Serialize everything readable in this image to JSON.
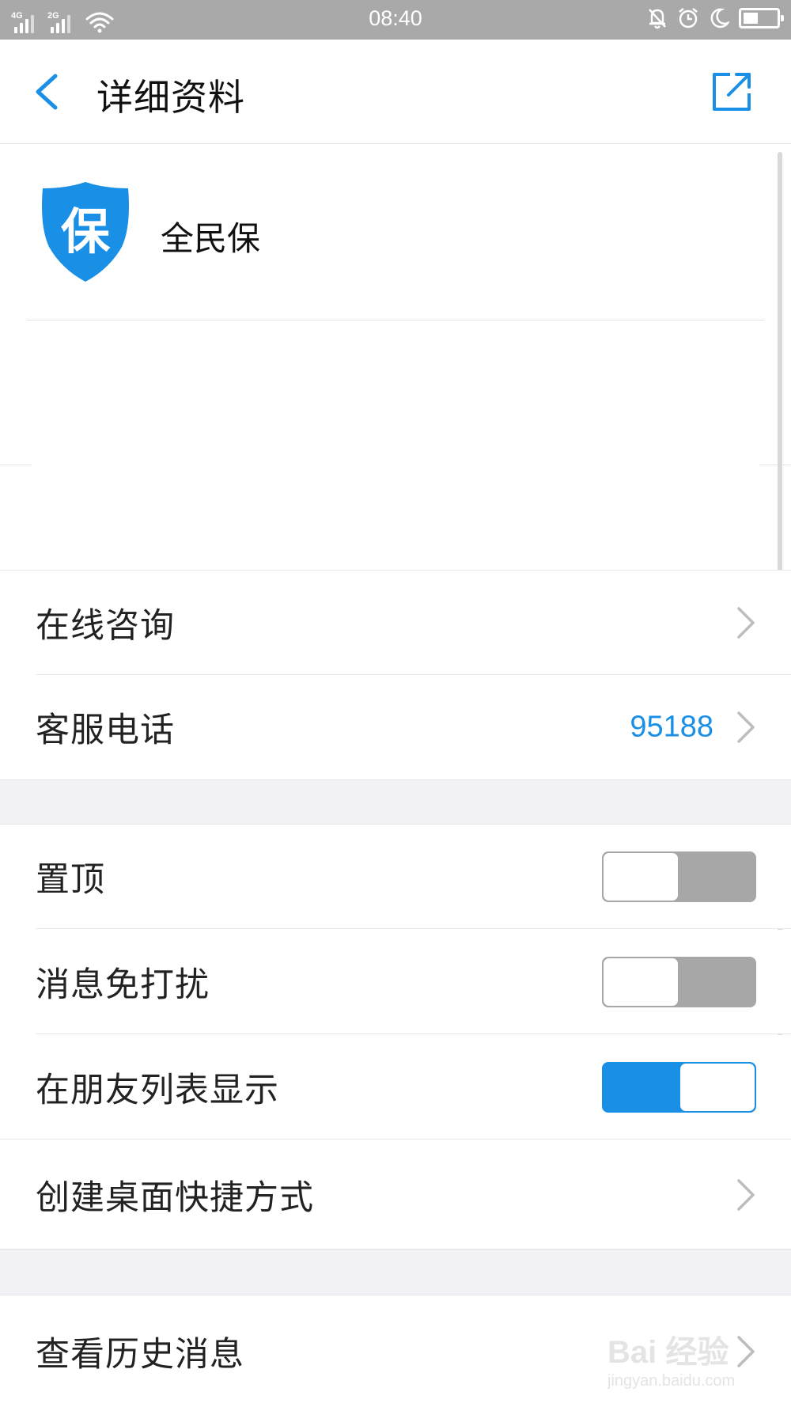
{
  "status_bar": {
    "network_1": "4G",
    "network_2": "2G",
    "time": "08:40",
    "battery_level": 0.4,
    "icons": [
      "signal-icon",
      "signal-icon",
      "wifi-icon",
      "mute-bell-icon",
      "alarm-icon",
      "moon-icon",
      "battery-icon"
    ]
  },
  "nav": {
    "title": "详细资料",
    "back_icon": "chevron-left-icon",
    "share_icon": "share-external-icon"
  },
  "profile": {
    "logo_char": "保",
    "name": "全民保"
  },
  "rows": {
    "consult": {
      "label": "在线咨询"
    },
    "phone": {
      "label": "客服电话",
      "value": "95188"
    },
    "pin": {
      "label": "置顶",
      "enabled": false
    },
    "mute": {
      "label": "消息免打扰",
      "enabled": false
    },
    "show_in_friends": {
      "label": "在朋友列表显示",
      "enabled": true
    },
    "shortcut": {
      "label": "创建桌面快捷方式"
    },
    "history": {
      "label": "查看历史消息"
    }
  },
  "watermark": {
    "brand": "Bai 经验",
    "url": "jingyan.baidu.com"
  },
  "colors": {
    "accent": "#1a8fe6",
    "status_bar": "#a9a9a9",
    "toggle_off": "#a7a7a7",
    "section_gap": "#f2f2f6"
  }
}
